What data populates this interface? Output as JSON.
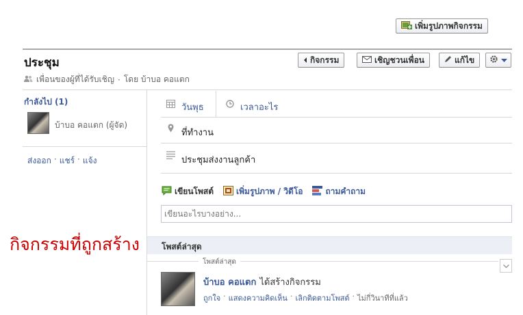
{
  "top": {
    "add_photo_label": "เพิ่มรูปภาพกิจกรรม"
  },
  "event": {
    "title": "ประชุม",
    "subtitle_privacy": "เพื่อนของผู้ที่ได้รับเชิญ",
    "subtitle_by": "โดย บ้าบอ คอแตก",
    "sep": "·"
  },
  "toolbar": {
    "events_label": "กิจกรรม",
    "invite_label": "เชิญชวนเพื่อน",
    "edit_label": "แก้ไข"
  },
  "sidebar": {
    "going_label": "กำลังไป (1)",
    "guest_name": "บ้าบอ คอแตก (ผู้จัด)",
    "links": [
      "ส่งออก",
      "แชร์",
      "แจ้ง"
    ]
  },
  "details": {
    "day": "วันพุธ",
    "time": "เวลาอะไร",
    "location": "ที่ทำงาน",
    "description": "ประชุมส่งงานลูกค้า"
  },
  "composer": {
    "tabs": [
      "เขียนโพสต์",
      "เพิ่มรูปภาพ / วิดีโอ",
      "ถามคำถาม"
    ],
    "placeholder": "เขียนอะไรบางอย่าง..."
  },
  "annotation": {
    "text": "กิจกรรมที่ถูกสร้าง",
    "color": "#cc0000"
  },
  "feed": {
    "header": "โพสต์ล่าสุด",
    "divider_label": "โพสต์ล่าสุด",
    "story": {
      "actor": "บ้าบอ คอแตก",
      "action": "ได้สร้างกิจกรรม",
      "actions": [
        "ถูกใจ",
        "แสดงความคิดเห็น",
        "เลิกติดตามโพสต์"
      ],
      "time": "ไม่กี่วินาทีที่แล้ว"
    }
  },
  "colors": {
    "link": "#3b5998",
    "border": "#d8d8d8",
    "header_bg": "#eceff5"
  }
}
